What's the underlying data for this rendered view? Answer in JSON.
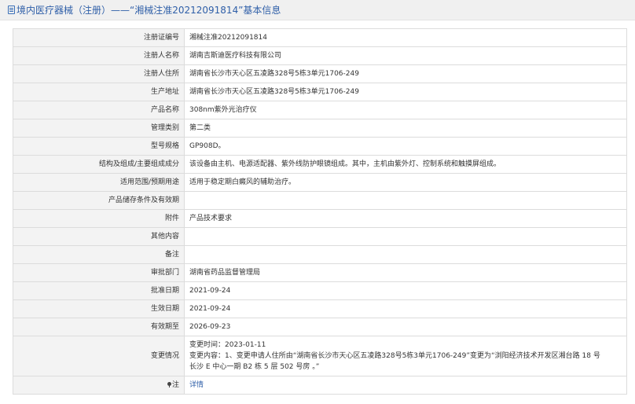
{
  "header": {
    "icon": "document-icon",
    "title": "境内医疗器械（注册）——“湘械注准20212091814”基本信息"
  },
  "rows": [
    {
      "label": "注册证编号",
      "value": "湘械注准20212091814"
    },
    {
      "label": "注册人名称",
      "value": "湖南吉斯迪医疗科技有限公司"
    },
    {
      "label": "注册人住所",
      "value": "湖南省长沙市天心区五凌路328号5栋3单元1706-249"
    },
    {
      "label": "生产地址",
      "value": "湖南省长沙市天心区五凌路328号5栋3单元1706-249"
    },
    {
      "label": "产品名称",
      "value": "308nm紫外光治疗仪"
    },
    {
      "label": "管理类别",
      "value": "第二类"
    },
    {
      "label": "型号规格",
      "value": "GP908D。"
    },
    {
      "label": "结构及组成/主要组成成分",
      "value": "该设备由主机、电源适配器、紫外线防护眼镜组成。其中，主机由紫外灯、控制系统和触摸屏组成。"
    },
    {
      "label": "适用范围/预期用途",
      "value": "适用于稳定期白癜风的辅助治疗。"
    },
    {
      "label": "产品储存条件及有效期",
      "value": ""
    },
    {
      "label": "附件",
      "value": "产品技术要求"
    },
    {
      "label": "其他内容",
      "value": ""
    },
    {
      "label": "备注",
      "value": ""
    },
    {
      "label": "审批部门",
      "value": "湖南省药品监督管理局"
    },
    {
      "label": "批准日期",
      "value": "2021-09-24"
    },
    {
      "label": "生效日期",
      "value": "2021-09-24"
    },
    {
      "label": "有效期至",
      "value": "2026-09-23"
    }
  ],
  "change": {
    "label": "变更情况",
    "line1": "变更时间：2023-01-11",
    "line2": "变更内容：1、变更申请人住所由“湖南省长沙市天心区五凌路328号5栋3单元1706-249”变更为“浏阳经济技术开发区湘台路 18 号",
    "line3": "长沙 E 中心一期 B2 栋 5 层 502 号房 。”"
  },
  "note": {
    "icon": "pin-icon",
    "label": "注",
    "link": "详情"
  }
}
